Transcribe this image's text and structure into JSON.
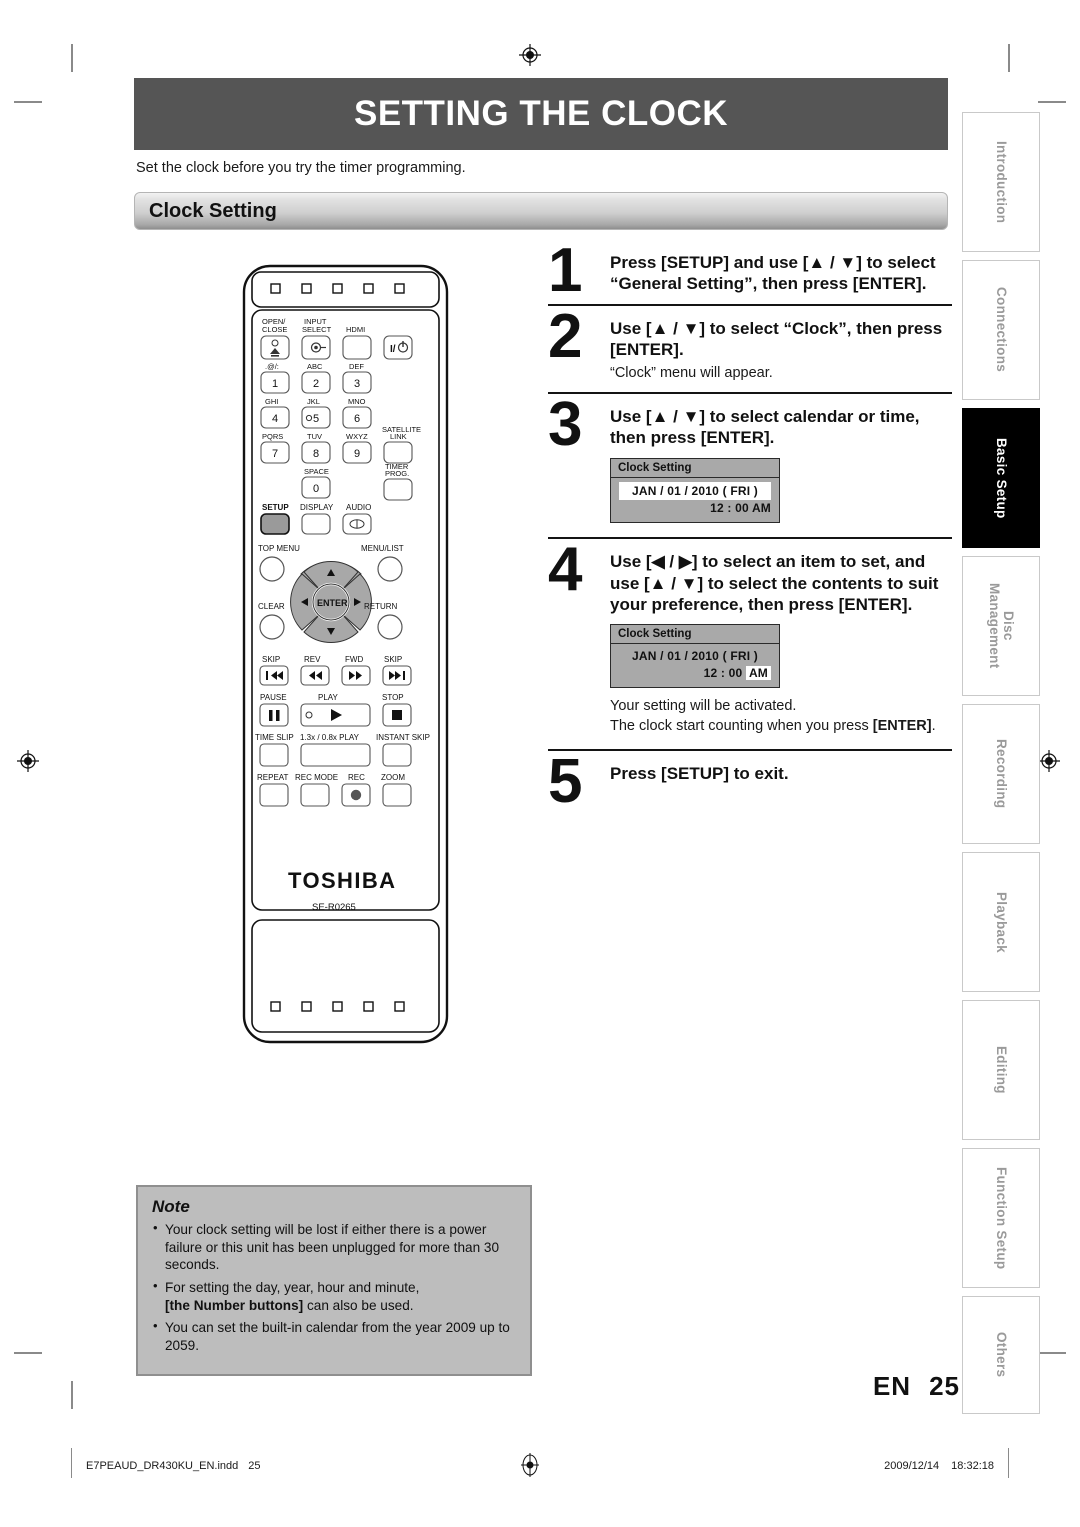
{
  "header": {
    "title": "SETTING THE CLOCK",
    "intro": "Set the clock before you try the timer programming.",
    "section_bar": "Clock Setting"
  },
  "steps": [
    {
      "number": "1",
      "heading": "Press [SETUP] and use [▲ / ▼] to select “General Setting”, then press [ENTER].",
      "sub": ""
    },
    {
      "number": "2",
      "heading": "Use [▲ / ▼] to select “Clock”, then press [ENTER].",
      "sub": "“Clock” menu will appear."
    },
    {
      "number": "3",
      "heading": "Use [▲ / ▼] to select calendar or time, then press [ENTER].",
      "sub": ""
    },
    {
      "number": "4",
      "heading": "Use [◀ / ▶] to select an item to set, and use [▲ / ▼] to select the contents to suit your preference, then press [ENTER].",
      "sub_line1": "Your setting will be activated.",
      "sub_line2": "The clock start counting when you press",
      "sub_line2_bold": "[ENTER]",
      "sub_line2_tail": "."
    },
    {
      "number": "5",
      "heading": "Press [SETUP] to exit.",
      "sub": ""
    }
  ],
  "osd": {
    "title": "Clock Setting",
    "date": "JAN / 01 / 2010 ( FRI )",
    "time_value": "12 : 00",
    "time_meridiem": "AM",
    "box3_highlight": "date",
    "box4_highlight": "meridiem"
  },
  "remote": {
    "brand": "TOSHIBA",
    "model": "SE-R0265",
    "labels": {
      "open_close": "OPEN/\nCLOSE",
      "input_select": "INPUT\nSELECT",
      "hdmi": "HDMI",
      "power": "I/⏻",
      "num1_alpha": ".@/:",
      "num2_alpha": "ABC",
      "num3_alpha": "DEF",
      "num4_alpha": "GHI",
      "num5_alpha": "JKL",
      "num6_alpha": "MNO",
      "num7_alpha": "PQRS",
      "num8_alpha": "TUV",
      "num9_alpha": "WXYZ",
      "num0_alpha": "SPACE",
      "satellite_link": "SATELLITE\nLINK",
      "timer_prog": "TIMER\nPROG.",
      "setup": "SETUP",
      "display": "DISPLAY",
      "audio": "AUDIO",
      "top_menu": "TOP MENU",
      "menu_list": "MENU/LIST",
      "clear": "CLEAR",
      "return": "RETURN",
      "enter": "ENTER",
      "skip_prev": "SKIP",
      "rev": "REV",
      "fwd": "FWD",
      "skip_next": "SKIP",
      "pause": "PAUSE",
      "play": "PLAY",
      "stop": "STOP",
      "time_slip": "TIME SLIP",
      "speed_play": "1.3x / 0.8x PLAY",
      "instant_skip": "INSTANT SKIP",
      "repeat": "REPEAT",
      "rec_mode": "REC MODE",
      "rec": "REC",
      "zoom": "ZOOM"
    },
    "numbers": [
      "1",
      "2",
      "3",
      "4",
      "5",
      "6",
      "7",
      "8",
      "9",
      "0"
    ]
  },
  "note": {
    "title": "Note",
    "items": [
      "Your clock setting will be lost if either there is a power failure or this unit has been unplugged for more than 30 seconds.",
      "For setting the day, year, hour and minute, [the Number buttons] can also be used.",
      "You can set the built-in calendar from the year 2009 up to 2059."
    ],
    "item2_prefix": "For setting the day, year, hour and minute,",
    "item2_bold": "[the Number buttons]",
    "item2_tail": "can also be used."
  },
  "tabs": [
    {
      "label": "Introduction",
      "active": false
    },
    {
      "label": "Connections",
      "active": false
    },
    {
      "label": "Basic Setup",
      "active": true
    },
    {
      "label": "Disc\nManagement",
      "active": false
    },
    {
      "label": "Recording",
      "active": false
    },
    {
      "label": "Playback",
      "active": false
    },
    {
      "label": "Editing",
      "active": false
    },
    {
      "label": "Function Setup",
      "active": false
    },
    {
      "label": "Others",
      "active": false
    }
  ],
  "page": {
    "lang": "EN",
    "number": "25"
  },
  "footer": {
    "file": "E7PEAUD_DR430KU_EN.indd",
    "page": "25",
    "date": "2009/12/14",
    "time": "18:32:18"
  },
  "colors": {
    "banner": "#555555",
    "tab_active_bg": "#000000",
    "note_bg": "#bdbdbd",
    "osd_bg": "#a9a9a9"
  }
}
